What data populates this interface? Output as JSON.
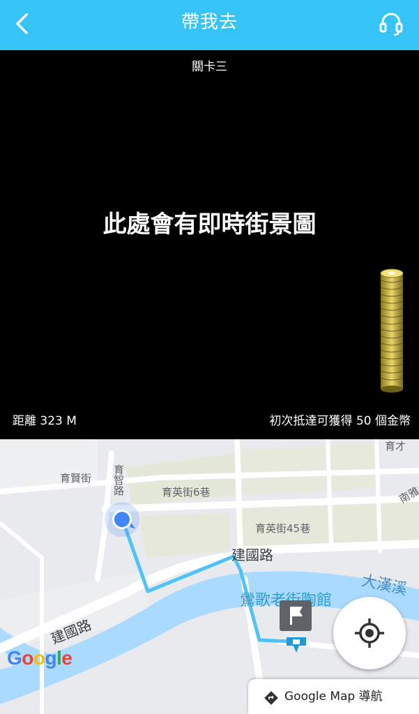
{
  "header": {
    "title": "帶我去",
    "back_icon": "chevron-left-icon",
    "support_icon": "headset-icon",
    "background": "#36c3f5"
  },
  "street_view": {
    "level_label": "關卡三",
    "placeholder": "此處會有即時街景圖",
    "distance": "距離 323 M",
    "reward": "初次抵達可獲得 50 個金幣",
    "coin_icon": "coin-stack-icon"
  },
  "map": {
    "labels": {
      "yuxian": "育賢街",
      "yuzhi": "育智路",
      "yuying6": "育英街6巷",
      "yuying45": "育英街45巷",
      "jianguo_top": "建國路",
      "jianguo_bottom": "建國路",
      "dahanxi": "大漢溪",
      "museum": "鶯歌老街陶館",
      "yuca": "育才",
      "nanya": "南雅"
    },
    "google_logo": [
      "G",
      "o",
      "o",
      "g",
      "l",
      "e"
    ],
    "google_colors": [
      "#4285f4",
      "#ea4335",
      "#fbbc05",
      "#4285f4",
      "#34a853",
      "#ea4335"
    ],
    "route_color": "#4fc3f7",
    "user_marker_color": "#4285f4"
  },
  "controls": {
    "locate_icon": "crosshair-icon",
    "nav_label": "Google Map 導航",
    "nav_icon": "directions-icon"
  }
}
